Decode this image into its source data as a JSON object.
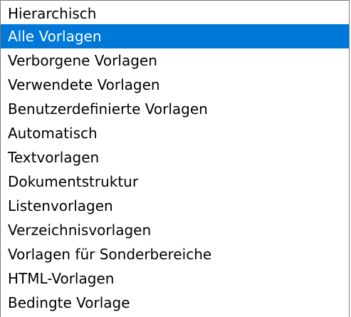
{
  "listbox": {
    "selected_index": 1,
    "items": [
      {
        "label": "Hierarchisch"
      },
      {
        "label": "Alle Vorlagen"
      },
      {
        "label": "Verborgene Vorlagen"
      },
      {
        "label": "Verwendete Vorlagen"
      },
      {
        "label": "Benutzerdefinierte Vorlagen"
      },
      {
        "label": "Automatisch"
      },
      {
        "label": "Textvorlagen"
      },
      {
        "label": "Dokumentstruktur"
      },
      {
        "label": "Listenvorlagen"
      },
      {
        "label": "Verzeichnisvorlagen"
      },
      {
        "label": "Vorlagen für Sonderbereiche"
      },
      {
        "label": "HTML-Vorlagen"
      },
      {
        "label": "Bedingte Vorlage"
      }
    ],
    "colors": {
      "selection_bg": "#0078d7",
      "selection_text": "#ffffff",
      "text": "#000000",
      "border": "#7a7a7a"
    }
  }
}
